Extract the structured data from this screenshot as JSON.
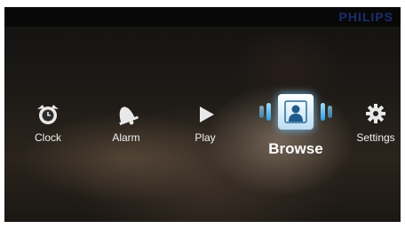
{
  "brand": "PHILIPS",
  "menu": {
    "items": [
      {
        "label": "Clock",
        "icon": "clock-icon"
      },
      {
        "label": "Alarm",
        "icon": "alarm-icon"
      },
      {
        "label": "Play",
        "icon": "play-icon"
      },
      {
        "label": "Browse",
        "icon": "browse-icon",
        "selected": true
      },
      {
        "label": "Settings",
        "icon": "settings-icon"
      }
    ]
  },
  "colors": {
    "brand": "#1b2e6e",
    "selection_glow": "#7cc8ff",
    "label": "#f0f0f0"
  }
}
